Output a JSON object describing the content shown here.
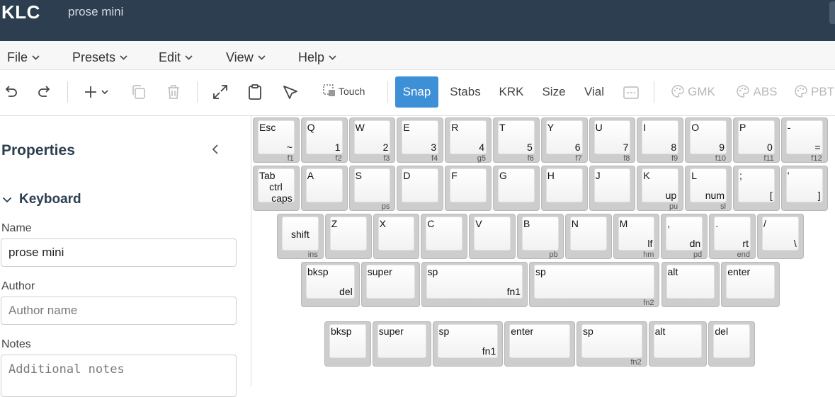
{
  "app": {
    "name": "KLC",
    "doc_title": "prose mini"
  },
  "menu": [
    {
      "id": "file",
      "label": "File"
    },
    {
      "id": "presets",
      "label": "Presets"
    },
    {
      "id": "edit",
      "label": "Edit"
    },
    {
      "id": "view",
      "label": "View"
    },
    {
      "id": "help",
      "label": "Help"
    }
  ],
  "toolbar": {
    "touch_label": "Touch",
    "snap_label": "Snap",
    "stabs_label": "Stabs",
    "krk_label": "KRK",
    "size_label": "Size",
    "vial_label": "Vial",
    "gmk_label": "GMK",
    "abs_label": "ABS",
    "pbt_label": "PBT",
    "accent_color": "#3d8fd6"
  },
  "sidebar": {
    "title": "Properties",
    "section": "Keyboard",
    "name_label": "Name",
    "name_value": "prose mini",
    "author_label": "Author",
    "author_placeholder": "Author name",
    "notes_label": "Notes",
    "notes_placeholder": "Additional notes"
  },
  "keyboard": {
    "keys": [
      {
        "tl": "Esc",
        "br": "~",
        "fr": "f1"
      },
      {
        "tl": "Q",
        "br": "1",
        "fr": "f2"
      },
      {
        "tl": "W",
        "br": "2",
        "fr": "f3"
      },
      {
        "tl": "E",
        "br": "3",
        "fr": "f4"
      },
      {
        "tl": "R",
        "br": "4",
        "fr": "g5"
      },
      {
        "tl": "T",
        "br": "5",
        "fr": "f6"
      },
      {
        "tl": "Y",
        "br": "6",
        "fr": "f7"
      },
      {
        "tl": "U",
        "br": "7",
        "fr": "f8"
      },
      {
        "tl": "I",
        "br": "8",
        "fr": "f9"
      },
      {
        "tl": "O",
        "br": "9",
        "fr": "f10"
      },
      {
        "tl": "P",
        "br": "0",
        "fr": "f11"
      },
      {
        "tl": "-",
        "br": "=",
        "fr": "f12"
      },
      {
        "stack": [
          "Tab",
          "ctrl",
          "caps"
        ]
      },
      {
        "tl": "A"
      },
      {
        "tl": "S",
        "fr": "ps"
      },
      {
        "tl": "D"
      },
      {
        "tl": "F"
      },
      {
        "tl": "G"
      },
      {
        "tl": "H"
      },
      {
        "tl": "J"
      },
      {
        "tl": "K",
        "br": "up",
        "fr": "pu"
      },
      {
        "tl": "L",
        "br": "num",
        "fr": "sl"
      },
      {
        "tl": ";",
        "br": "["
      },
      {
        "tl": "'",
        "br": "]"
      },
      {
        "ctr": "shift",
        "fr": "ins"
      },
      {
        "tl": "Z"
      },
      {
        "tl": "X"
      },
      {
        "tl": "C"
      },
      {
        "tl": "V"
      },
      {
        "tl": "B",
        "fr": "pb"
      },
      {
        "tl": "N"
      },
      {
        "tl": "M",
        "br": "lf",
        "fr": "hm"
      },
      {
        "tl": ",",
        "br": "dn",
        "fr": "pd"
      },
      {
        "tl": ".",
        "br": "rt",
        "fr": "end"
      },
      {
        "tl": "/",
        "br": "\\"
      },
      {
        "tl": "bksp",
        "br": "del"
      },
      {
        "tl": "super"
      },
      {
        "tl": "sp",
        "br": "fn1"
      },
      {
        "tl": "sp",
        "fr": "fn2"
      },
      {
        "tl": "alt"
      },
      {
        "tl": "enter"
      },
      {
        "tl": "bksp"
      },
      {
        "tl": "super"
      },
      {
        "tl": "sp",
        "br": "fn1"
      },
      {
        "tl": "enter"
      },
      {
        "tl": "sp",
        "fr": "fn2"
      },
      {
        "tl": "alt"
      },
      {
        "tl": "del"
      }
    ]
  }
}
